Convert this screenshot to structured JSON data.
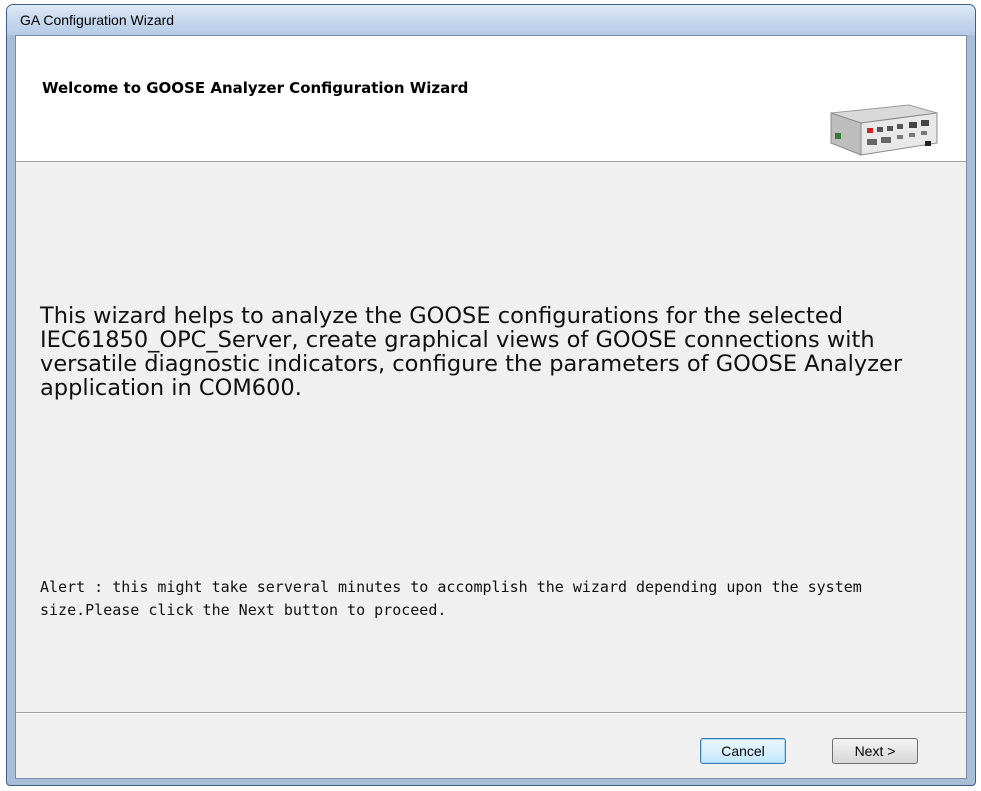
{
  "window": {
    "title": "GA Configuration Wizard"
  },
  "header": {
    "title": "Welcome to GOOSE Analyzer Configuration Wizard",
    "image_icon": "device-image"
  },
  "body": {
    "description": "This wizard helps to analyze the GOOSE configurations for the selected IEC61850_OPC_Server, create graphical views of GOOSE connections with versatile diagnostic indicators, configure the parameters of GOOSE Analyzer application in COM600.",
    "alert": "Alert : this might take serveral minutes to accomplish the wizard depending upon the system size.Please click the Next button to proceed."
  },
  "buttons": {
    "cancel_label": "Cancel",
    "next_label": "Next >"
  },
  "colors": {
    "titlebar": "#c7d8ee",
    "frame": "#a8bdd6",
    "client_bg": "#f0f0f0",
    "header_bg": "#ffffff",
    "focus_border": "#3c7fb1"
  }
}
